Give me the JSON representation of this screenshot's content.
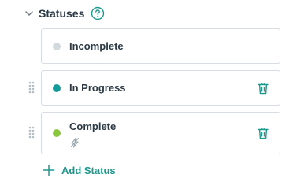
{
  "section": {
    "title": "Statuses",
    "help_icon": "question-circle-icon",
    "collapse_icon": "chevron-down-icon"
  },
  "statuses": [
    {
      "label": "Incomplete",
      "color": "#d3dadd",
      "deletable": false,
      "automation": false
    },
    {
      "label": "In Progress",
      "color": "#159a99",
      "deletable": true,
      "automation": false
    },
    {
      "label": "Complete",
      "color": "#8cc63f",
      "deletable": true,
      "automation": true
    }
  ],
  "add_button": {
    "label": "Add Status",
    "icon": "plus-icon"
  },
  "colors": {
    "accent": "#1a9a8e",
    "text": "#2b3a45",
    "border": "#d7dde2",
    "muted_icon": "#9aa6ae"
  }
}
